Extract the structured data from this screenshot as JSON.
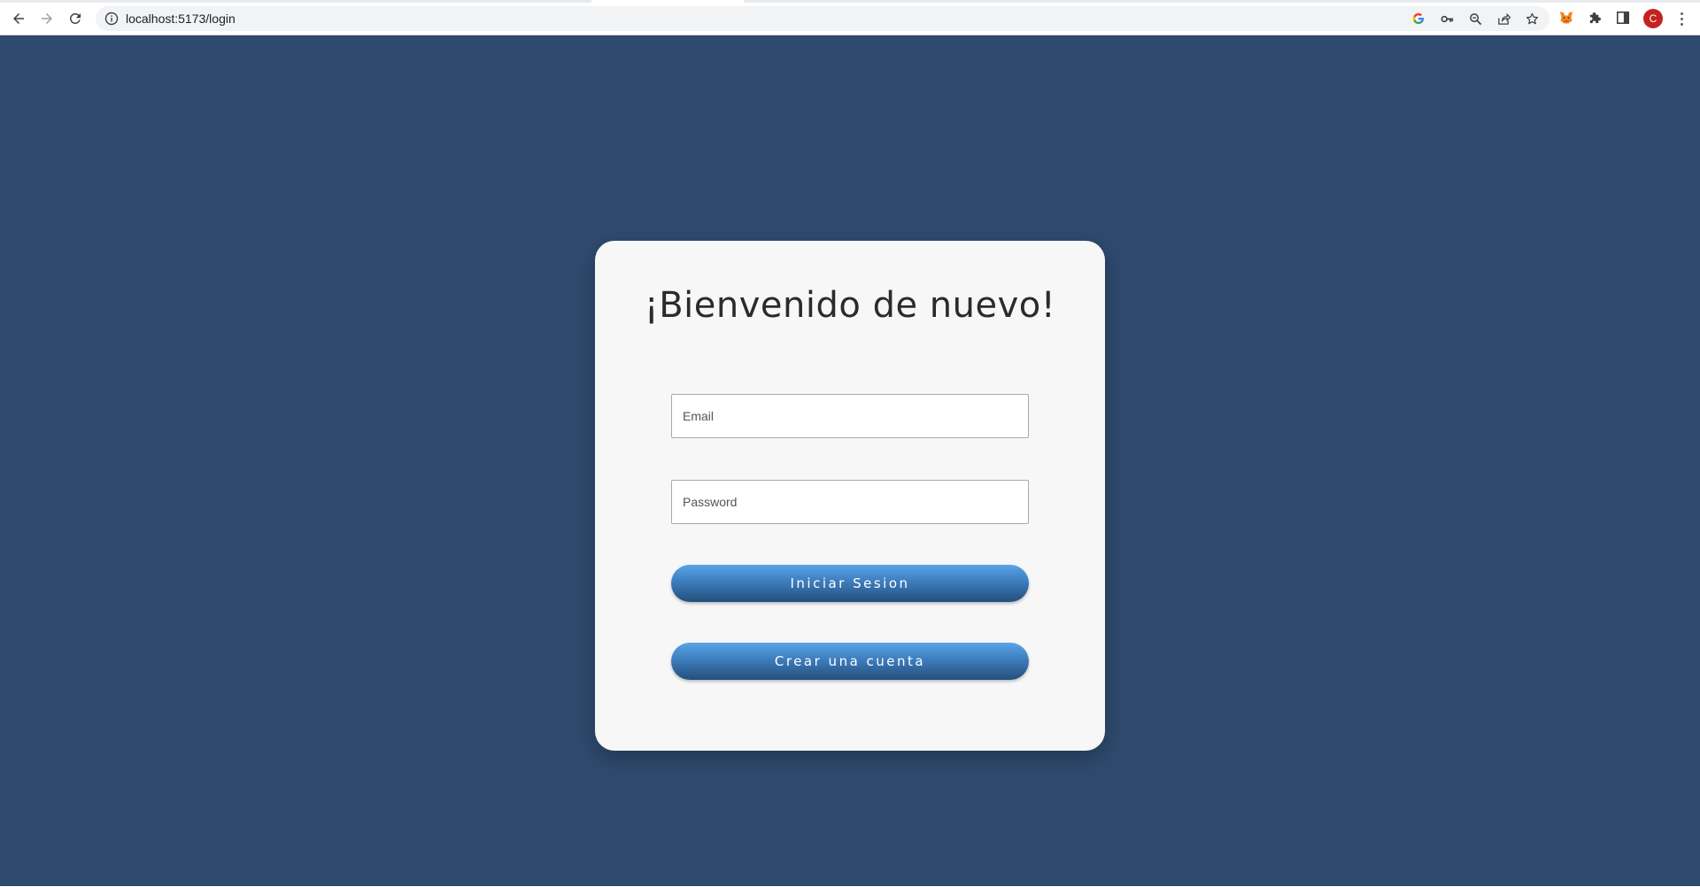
{
  "browser": {
    "url": "localhost:5173/login",
    "avatar_letter": "C",
    "icons": [
      "back-icon",
      "forward-icon",
      "reload-icon",
      "info-icon",
      "google-icon",
      "key-icon",
      "zoom-icon",
      "share-icon",
      "star-icon",
      "metamask-fox-icon",
      "puzzle-icon",
      "side-panel-icon",
      "kebab-menu-icon"
    ]
  },
  "colors": {
    "page_background": "#2e4a6e",
    "card_background": "#f7f7f7",
    "button_gradient_top": "#58a4e8",
    "button_gradient_bottom": "#264f7c",
    "avatar": "#c5221f"
  },
  "login": {
    "title": "¡Bienvenido de nuevo!",
    "email_placeholder": "Email",
    "password_placeholder": "Password",
    "login_button": "Iniciar Sesion",
    "register_button": "Crear una cuenta"
  }
}
